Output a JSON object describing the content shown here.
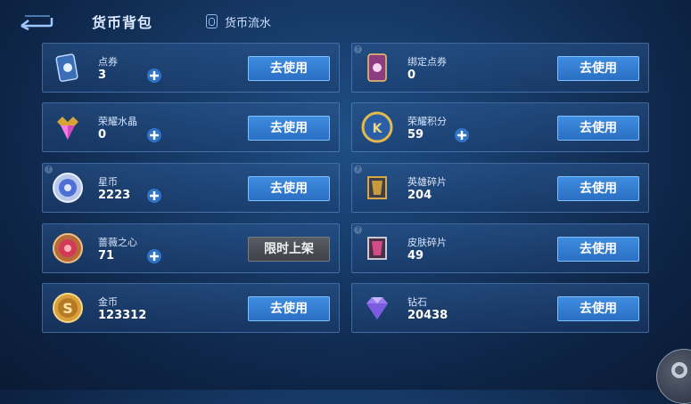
{
  "header": {
    "title": "货币背包",
    "flow_label": "货币流水"
  },
  "colors": {
    "accent_button": "#3f8de0",
    "disabled_button": "#5a5e64",
    "background": "#163a67"
  },
  "currencies_left": [
    {
      "name": "点券",
      "value": "3",
      "button": "去使用",
      "icon": "coupon-card-icon",
      "has_plus": true
    },
    {
      "name": "荣耀水晶",
      "value": "0",
      "button": "去使用",
      "icon": "glory-crystal-icon",
      "has_plus": true
    },
    {
      "name": "星币",
      "value": "2223",
      "button": "去使用",
      "icon": "star-coin-icon",
      "has_plus": true
    },
    {
      "name": "蔷薇之心",
      "value": "71",
      "button": "限时上架",
      "icon": "rose-heart-icon",
      "has_plus": true
    },
    {
      "name": "金币",
      "value": "123312",
      "button": "去使用",
      "icon": "gold-coin-icon",
      "has_plus": false
    }
  ],
  "currencies_right": [
    {
      "name": "绑定点券",
      "value": "0",
      "button": "去使用",
      "icon": "bound-coupon-icon",
      "has_plus": false
    },
    {
      "name": "荣耀积分",
      "value": "59",
      "button": "去使用",
      "icon": "glory-points-icon",
      "has_plus": true
    },
    {
      "name": "英雄碎片",
      "value": "204",
      "button": "去使用",
      "icon": "hero-fragment-icon",
      "has_plus": false
    },
    {
      "name": "皮肤碎片",
      "value": "49",
      "button": "去使用",
      "icon": "skin-fragment-icon",
      "has_plus": false
    },
    {
      "name": "钻石",
      "value": "20438",
      "button": "去使用",
      "icon": "diamond-icon",
      "has_plus": false
    }
  ]
}
